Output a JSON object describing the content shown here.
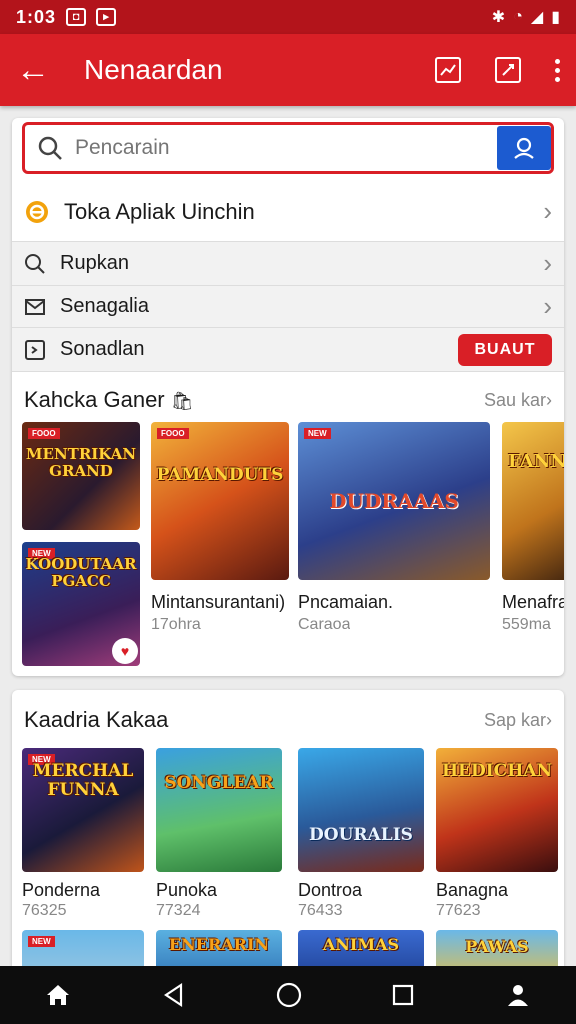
{
  "status": {
    "time": "1:03"
  },
  "appbar": {
    "title": "Nenaardan"
  },
  "search": {
    "placeholder": "Pencarain"
  },
  "menu": {
    "store_label": "Toka Apliak Uinchin",
    "item2_label": "Rupkan",
    "item3_label": "Senagalia",
    "item4_label": "Sonadlan",
    "item4_button": "BUAUT"
  },
  "section1": {
    "title": "Kahcka Ganer",
    "more": "Sau kar",
    "small_games": [
      {
        "art": "MENTRIKAN GRAND",
        "badge": "FOOO"
      },
      {
        "art": "KOODUTAAR PGACC",
        "badge": "NEW"
      }
    ],
    "games": [
      {
        "name": "Mintansurantani)",
        "sub": "17ohra",
        "art": "PAMANDUTS",
        "badge": "FOOO"
      },
      {
        "name": "Pncamaian.",
        "sub": "Caraoa",
        "art": "DUDRAAAS",
        "badge": "NEW"
      },
      {
        "name": "Menafra",
        "sub": "559ma",
        "art": "FANNA",
        "badge": ""
      }
    ]
  },
  "section2": {
    "title": "Kaadria Kakaa",
    "more": "Sap kar",
    "games": [
      {
        "name": "Ponderna",
        "sub": "76325",
        "art": "MERCHAL FUNNA",
        "badge": "NEW"
      },
      {
        "name": "Punoka",
        "sub": "77324",
        "art": "SONGLEAR",
        "badge": ""
      },
      {
        "name": "Dontroa",
        "sub": "76433",
        "art": "DOURALIS",
        "badge": ""
      },
      {
        "name": "Banagna",
        "sub": "77623",
        "art": "HEDICHAN",
        "badge": ""
      }
    ],
    "peek": [
      {
        "art": "",
        "badge": "NEW"
      },
      {
        "art": "ENERARIN",
        "badge": ""
      },
      {
        "art": "ANIMAS",
        "badge": ""
      },
      {
        "art": "PAWAS",
        "badge": ""
      }
    ]
  },
  "colors": {
    "brand": "#d91f26",
    "accent": "#1c5bd0"
  }
}
